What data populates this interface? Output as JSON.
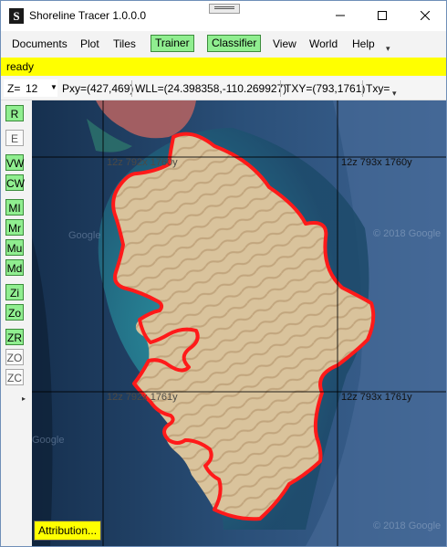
{
  "window": {
    "title": "Shoreline Tracer 1.0.0.0",
    "icon_glyph": "S"
  },
  "menubar": {
    "items": [
      "Documents",
      "Plot",
      "Tiles"
    ],
    "toggles": [
      "Trainer",
      "Classifier"
    ],
    "items_right": [
      "View",
      "World",
      "Help"
    ]
  },
  "status": {
    "text": "ready"
  },
  "coords": {
    "zoom_label": "Z=",
    "zoom_value": "12",
    "pxy": "Pxy=(427,469)",
    "wll": "WLL=(24.398358,-110.269927)",
    "txy": "TXY=(793,1761)",
    "txy2": "Txy="
  },
  "sidebar": {
    "buttons": [
      {
        "label": "R",
        "active": true
      },
      {
        "label": "E",
        "active": false
      },
      {
        "label": "VW",
        "active": true
      },
      {
        "label": "CW",
        "active": true
      },
      {
        "label": "MI",
        "active": true
      },
      {
        "label": "Mr",
        "active": true
      },
      {
        "label": "Mu",
        "active": true
      },
      {
        "label": "Md",
        "active": true
      },
      {
        "label": "Zi",
        "active": true
      },
      {
        "label": "Zo",
        "active": true
      },
      {
        "label": "ZR",
        "active": true
      },
      {
        "label": "ZO",
        "active": false
      },
      {
        "label": "ZC",
        "active": false
      }
    ]
  },
  "map": {
    "tiles": [
      {
        "label": "12z 792x 1760y"
      },
      {
        "label": "12z 793x 1760y"
      },
      {
        "label": "12z 792x 1761y"
      },
      {
        "label": "12z 793x 1761y"
      }
    ],
    "watermark": "© 2018 Google",
    "watermark_short": "Google",
    "attribution": "Attribution...",
    "trace_color": "#ff1a1a",
    "land_color": "#d6bf96",
    "water_color": "#1c3a5c"
  },
  "colors": {
    "toggle_on": "#90ee90",
    "status_bg": "#ffff00"
  }
}
